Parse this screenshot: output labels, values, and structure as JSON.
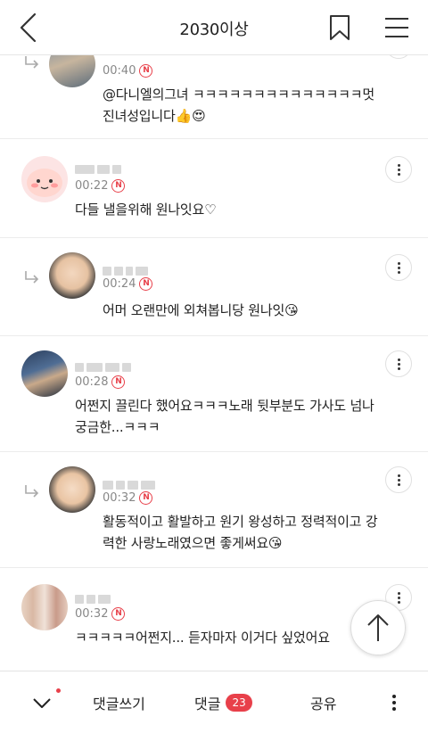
{
  "header": {
    "title": "2030이상"
  },
  "comments": [
    {
      "time": "00:40",
      "badge": "N",
      "line1": "@다니엘의그녀  ㅋㅋㅋㅋㅋㅋㅋㅋㅋㅋㅋㅋㅋㅋ멋",
      "line2": "진녀성입니다👍😍"
    },
    {
      "time": "00:22",
      "badge": "N",
      "line1": "다들 낼을위해 원나잇요♡"
    },
    {
      "time": "00:24",
      "badge": "N",
      "line1": "어머 오랜만에 외쳐봅니당 원나잇😘"
    },
    {
      "time": "00:28",
      "badge": "N",
      "line1": "어쩐지 끌린다 했어요ㅋㅋㅋ노래 뒷부분도 가사도 넘나",
      "line2": "궁금한...ㅋㅋㅋ"
    },
    {
      "time": "00:32",
      "badge": "N",
      "line1": "활동적이고 활발하고 원기 왕성하고 정력적이고 강",
      "line2": "력한 사랑노래였으면 좋게써요😘"
    },
    {
      "time": "00:32",
      "badge": "N",
      "line1": "ㅋㅋㅋㅋㅋ어쩐지... 듣자마자 이거다 싶었어요"
    }
  ],
  "bottom": {
    "write_label": "댓글쓰기",
    "comments_label": "댓글",
    "comments_count": "23",
    "share_label": "공유"
  },
  "colors": {
    "accent": "#e8404a"
  }
}
